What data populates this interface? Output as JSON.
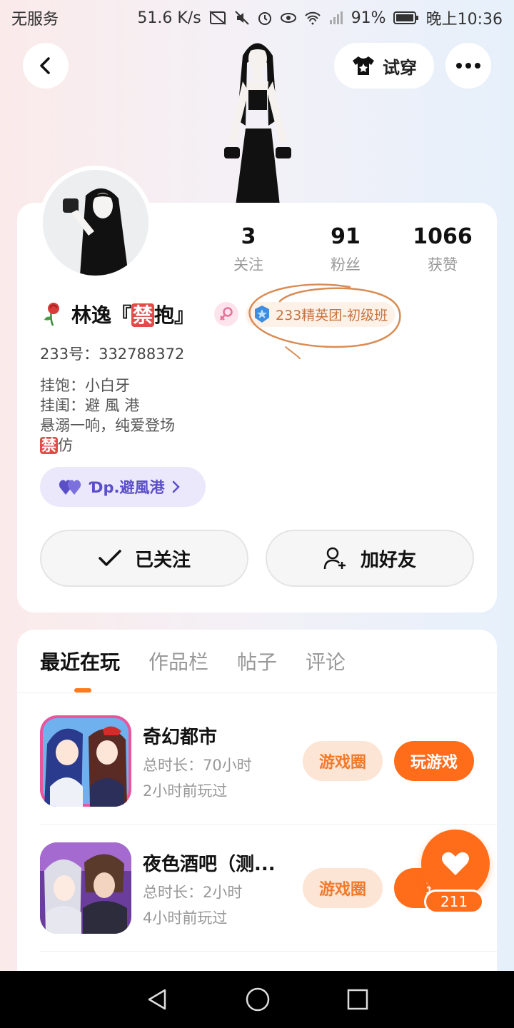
{
  "status_bar": {
    "carrier": "无服务",
    "speed": "51.6 K/s",
    "battery": "91%",
    "time": "晚上10:36"
  },
  "header": {
    "tryon_label": "试穿"
  },
  "profile": {
    "stats": [
      {
        "value": "3",
        "label": "关注"
      },
      {
        "value": "91",
        "label": "粉丝"
      },
      {
        "value": "1066",
        "label": "获赞"
      }
    ],
    "name_prefix": "林逸『",
    "name_ban": "禁",
    "name_suffix": "抱』",
    "elite_badge": "233精英团-初级班",
    "account_id": "233号：332788372",
    "bio_lines": [
      "挂饱：小白牙",
      "挂闺：避 風 港",
      "悬溺一响，纯爱登场"
    ],
    "bio_ban": "禁",
    "bio_last": "仿",
    "link_chip": "Ɗp.避風港",
    "followed_label": "已关注",
    "add_friend_label": "加好友"
  },
  "tabs": [
    "最近在玩",
    "作品栏",
    "帖子",
    "评论"
  ],
  "games": [
    {
      "title": "奇幻都市",
      "duration": "总时长：70小时",
      "last_played": "2小时前玩过",
      "circle_label": "游戏圈",
      "play_label": "玩游戏"
    },
    {
      "title": "夜色酒吧（测...",
      "duration": "总时长：2小时",
      "last_played": "4小时前玩过",
      "circle_label": "游戏圈",
      "play_label": "玩"
    }
  ],
  "favorite": {
    "count": "211"
  },
  "colors": {
    "accent": "#ff6d1a",
    "badge_text": "#c9733d",
    "chip": "#5b4fc8"
  }
}
